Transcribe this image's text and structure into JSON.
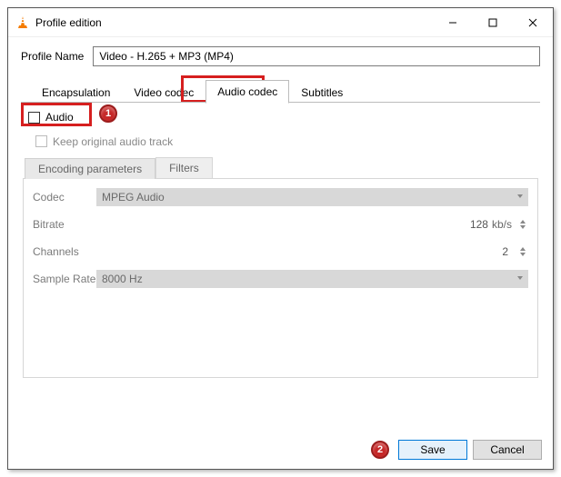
{
  "window": {
    "title": "Profile edition"
  },
  "profile": {
    "name_label": "Profile Name",
    "name_value": "Video - H.265 + MP3 (MP4)"
  },
  "tabs": {
    "encapsulation": "Encapsulation",
    "video_codec": "Video codec",
    "audio_codec": "Audio codec",
    "subtitles": "Subtitles"
  },
  "audio_panel": {
    "audio_label": "Audio",
    "keep_original_label": "Keep original audio track",
    "subtabs": {
      "encoding": "Encoding parameters",
      "filters": "Filters"
    },
    "rows": {
      "codec": {
        "label": "Codec",
        "value": "MPEG Audio"
      },
      "bitrate": {
        "label": "Bitrate",
        "value": "128",
        "unit": "kb/s"
      },
      "channels": {
        "label": "Channels",
        "value": "2"
      },
      "sample_rate": {
        "label": "Sample Rate",
        "value": "8000 Hz"
      }
    }
  },
  "buttons": {
    "save": "Save",
    "cancel": "Cancel"
  },
  "callouts": {
    "one": "1",
    "two": "2"
  }
}
